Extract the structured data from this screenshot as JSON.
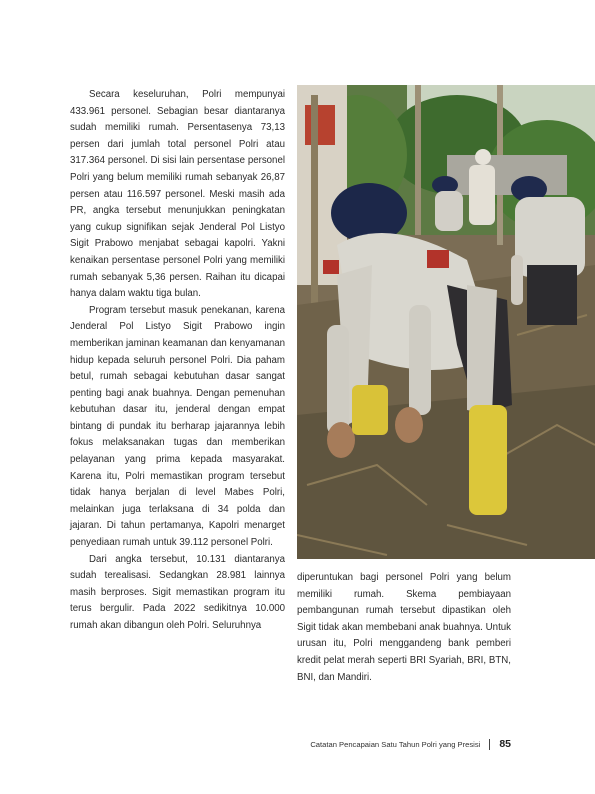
{
  "body_left": {
    "p1": "Secara keseluruhan, Polri mempunyai 433.961 personel. Sebagian besar diantaranya sudah memiliki rumah. Persentasenya 73,13 persen dari jumlah total personel Polri atau 317.364 personel. Di sisi lain persentase personel Polri yang belum memiliki rumah sebanyak 26,87 persen atau 116.597 personel. Meski masih ada PR, angka tersebut menunjukkan peningkatan yang cukup signifikan sejak Jenderal Pol Listyo Sigit Prabowo menjabat sebagai kapolri. Yakni kenaikan persentase personel Polri yang memiliki rumah sebanyak 5,36 persen. Raihan itu dicapai hanya dalam waktu tiga bulan.",
    "p2": "Program tersebut masuk penekanan, karena Jenderal Pol Listyo Sigit Prabowo ingin memberikan jaminan keamanan dan kenyamanan hidup kepada seluruh personel Polri. Dia paham betul, rumah sebagai kebutuhan dasar sangat penting bagi anak buahnya. Dengan pemenuhan kebutuhan dasar itu, jenderal dengan empat bintang di pundak itu berharap jajarannya lebih fokus melaksanakan tugas dan memberikan pelayanan yang prima kepada masyarakat. Karena itu, Polri memastikan program tersebut tidak hanya berjalan di level Mabes Polri, melainkan juga terlaksana di 34 polda dan jajaran. Di tahun pertamanya, Kapolri menarget penyediaan rumah untuk 39.112 personel Polri.",
    "p3": "Dari angka tersebut, 10.131 diantaranya sudah terealisasi. Sedangkan 28.981 lainnya masih berproses. Sigit memastikan program itu terus bergulir. Pada 2022 sedikitnya 10.000 rumah akan dibangun oleh Polri. Seluruhnya"
  },
  "body_right": {
    "p1": "diperuntukan bagi personel Polri yang belum memiliki rumah. Skema pembiayaan pembangunan rumah tersebut dipastikan oleh Sigit tidak akan membebani anak buahnya. Untuk urusan itu, Polri menggandeng bank pemberi kredit pelat merah seperti BRI Syariah, BRI, BTN, BNI, dan Mandiri."
  },
  "footer": {
    "running_title": "Catatan Pencapaian Satu Tahun Polri yang Presisi",
    "page_number": "85"
  }
}
